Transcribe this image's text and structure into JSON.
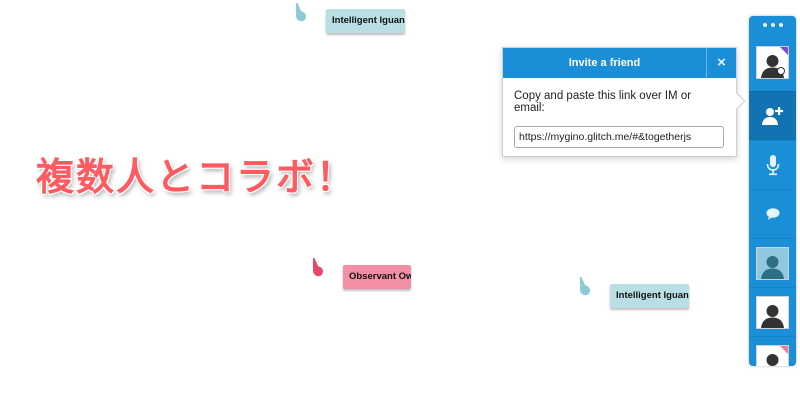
{
  "headline": "複数人とコラボ！",
  "cursors": [
    {
      "name": "Intelligent Iguana",
      "color": "#b9dfe5"
    },
    {
      "name": "Observant Owl",
      "color": "#f38fa5"
    },
    {
      "name": "Intelligent Iguana",
      "color": "#b9dfe5"
    }
  ],
  "invite": {
    "title": "Invite a friend",
    "close_icon": "×",
    "instructions": "Copy and paste this link over IM or email:",
    "link": "https://mygino.glitch.me/#&togetherjs"
  },
  "dock": {
    "handle_icon": "drag-dots",
    "buttons": [
      {
        "name": "self-avatar",
        "icon": "person-icon"
      },
      {
        "name": "invite",
        "icon": "add-user-icon"
      },
      {
        "name": "audio",
        "icon": "microphone-icon"
      },
      {
        "name": "chat",
        "icon": "chat-bubble-icon"
      },
      {
        "name": "participant-teal",
        "icon": "person-icon"
      },
      {
        "name": "participant-white",
        "icon": "person-icon"
      },
      {
        "name": "participant-pink",
        "icon": "person-icon"
      }
    ]
  },
  "colors": {
    "accent": "#1a8fd8",
    "accent_dark": "#1273b2",
    "headline": "#ff5a5f"
  }
}
